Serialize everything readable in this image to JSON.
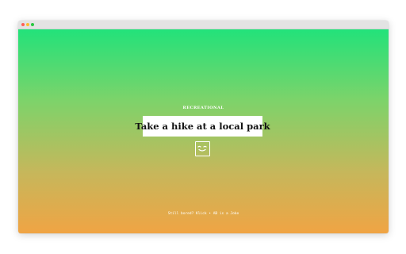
{
  "window": {
    "controls": [
      "close",
      "minimize",
      "maximize"
    ]
  },
  "activity": {
    "category": "RECREATIONAL",
    "text": "Take a hike at a local park",
    "icon": "smiling-face-icon"
  },
  "footer": {
    "prefix": "Still bored?",
    "reload_label": "Klick",
    "separator": "•",
    "link_label": "AB is a Joke"
  },
  "colors": {
    "gradient_top": "#22e27a",
    "gradient_mid": "#c6b75b",
    "gradient_bottom": "#f0a444",
    "card_bg": "#ffffff",
    "text": "#111111"
  }
}
